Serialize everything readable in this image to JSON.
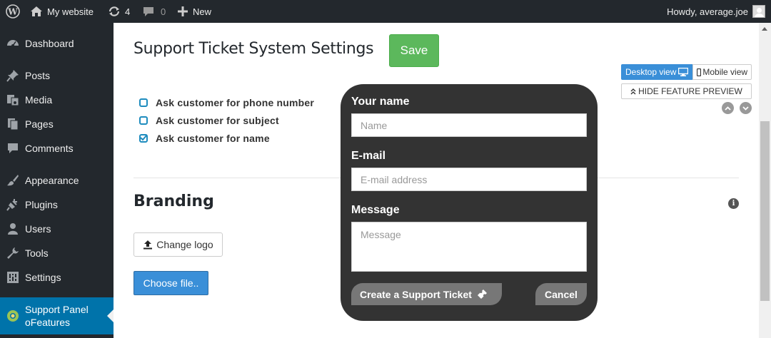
{
  "adminbar": {
    "site_name": "My website",
    "updates_count": "4",
    "comments_count": "0",
    "new_label": "New",
    "greeting": "Howdy, average.joe"
  },
  "sidebar": {
    "items": [
      {
        "label": "Dashboard",
        "icon": "dashboard-icon"
      },
      {
        "label": "Posts",
        "icon": "pin-icon"
      },
      {
        "label": "Media",
        "icon": "media-icon"
      },
      {
        "label": "Pages",
        "icon": "pages-icon"
      },
      {
        "label": "Comments",
        "icon": "comments-icon"
      },
      {
        "label": "Appearance",
        "icon": "brush-icon"
      },
      {
        "label": "Plugins",
        "icon": "plugin-icon"
      },
      {
        "label": "Users",
        "icon": "user-icon"
      },
      {
        "label": "Tools",
        "icon": "wrench-icon"
      },
      {
        "label": "Settings",
        "icon": "settings-icon"
      }
    ],
    "active_line1": "Support Panel",
    "active_line2": "oFeatures"
  },
  "main": {
    "title": "Support Ticket System Settings",
    "save_label": "Save",
    "desktop_view_label": "Desktop view",
    "mobile_view_label": "Mobile view",
    "hide_preview_label": "HIDE FEATURE PREVIEW",
    "options": [
      {
        "label": "Ask customer for phone number",
        "checked": false
      },
      {
        "label": "Ask customer for subject",
        "checked": false
      },
      {
        "label": "Ask customer for name",
        "checked": true
      }
    ],
    "branding_title": "Branding",
    "change_logo_label": "Change logo",
    "choose_file_label": "Choose file.."
  },
  "preview": {
    "name_label": "Your name",
    "name_placeholder": "Name",
    "email_label": "E-mail",
    "email_placeholder": "E-mail address",
    "message_label": "Message",
    "message_placeholder": "Message",
    "submit_label": "Create a Support Ticket",
    "cancel_label": "Cancel"
  },
  "colors": {
    "adminbar_bg": "#23282d",
    "active_menu": "#0073aa",
    "save_green": "#5cb85c",
    "primary_blue": "#3a8fd8",
    "preview_bg": "#333333"
  }
}
